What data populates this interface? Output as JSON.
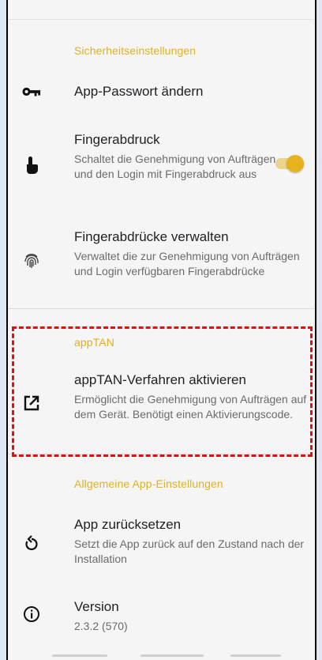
{
  "sections": {
    "security_header": "Sicherheitseinstellungen",
    "apptan_header": "appTAN",
    "general_header": "Allgemeine App-Einstellungen"
  },
  "items": {
    "change_password": {
      "title": "App-Passwort ändern",
      "icon": "key-icon"
    },
    "fingerprint": {
      "title": "Fingerabdruck",
      "description": "Schaltet die Genehmigung von Aufträgen und den Login mit Fingerabdruck aus",
      "icon": "touch-icon",
      "toggle_on": true
    },
    "manage_fingerprints": {
      "title": "Fingerabdrücke verwalten",
      "description": "Verwaltet die zur Genehmigung von Aufträgen und Login verfügbaren Fingerabdrücke",
      "icon": "fingerprint-icon"
    },
    "apptan_activate": {
      "title": "appTAN-Verfahren aktivieren",
      "description": "Ermöglicht die Genehmigung von Aufträgen auf dem Gerät. Benötigt einen Aktivierungscode.",
      "icon": "open-external-icon"
    },
    "reset_app": {
      "title": "App zurücksetzen",
      "description": "Setzt die App zurück auf den Zustand nach der Installation",
      "icon": "reset-icon"
    },
    "version": {
      "title": "Version",
      "value": "2.3.2 (570)",
      "icon": "info-icon"
    }
  },
  "colors": {
    "accent": "#e0b21f",
    "highlight": "#e01010"
  }
}
